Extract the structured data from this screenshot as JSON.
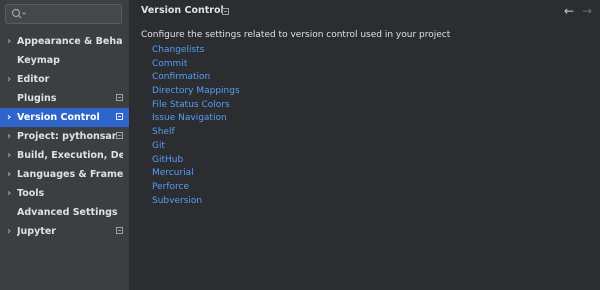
{
  "search": {
    "icon": "search-icon",
    "placeholder": ""
  },
  "sidebar": {
    "items": [
      {
        "label": "Appearance & Behavior",
        "expandable": true,
        "badge": false,
        "selected": false
      },
      {
        "label": "Keymap",
        "expandable": false,
        "badge": false,
        "selected": false
      },
      {
        "label": "Editor",
        "expandable": true,
        "badge": false,
        "selected": false
      },
      {
        "label": "Plugins",
        "expandable": false,
        "badge": true,
        "selected": false
      },
      {
        "label": "Version Control",
        "expandable": true,
        "badge": true,
        "selected": true
      },
      {
        "label": "Project: pythonsandbox",
        "expandable": true,
        "badge": true,
        "selected": false
      },
      {
        "label": "Build, Execution, Deployment",
        "expandable": true,
        "badge": false,
        "selected": false
      },
      {
        "label": "Languages & Frameworks",
        "expandable": true,
        "badge": false,
        "selected": false
      },
      {
        "label": "Tools",
        "expandable": true,
        "badge": false,
        "selected": false
      },
      {
        "label": "Advanced Settings",
        "expandable": false,
        "badge": false,
        "selected": false
      },
      {
        "label": "Jupyter",
        "expandable": true,
        "badge": true,
        "selected": false
      }
    ]
  },
  "header": {
    "title": "Version Control",
    "back_icon": "←",
    "forward_icon": "→"
  },
  "main": {
    "description": "Configure the settings related to version control used in your project",
    "links": [
      "Changelists",
      "Commit",
      "Confirmation",
      "Directory Mappings",
      "File Status Colors",
      "Issue Navigation",
      "Shelf",
      "Git",
      "GitHub",
      "Mercurial",
      "Perforce",
      "Subversion"
    ]
  },
  "colors": {
    "sidebar_bg": "#3c3f41",
    "main_bg": "#2b2d30",
    "selection": "#2f65ca",
    "link": "#589df6"
  }
}
